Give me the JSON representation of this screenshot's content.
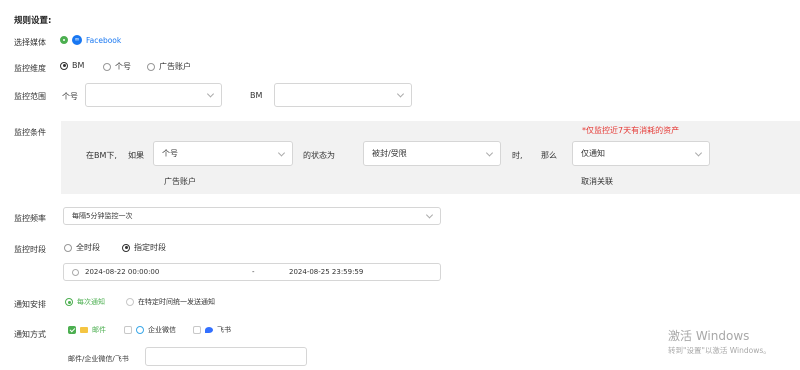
{
  "rule_title": "规则设置:",
  "media": {
    "label": "选择媒体",
    "option": "Facebook",
    "accent": "#1877f2"
  },
  "dimension": {
    "label": "监控维度",
    "options": [
      "BM",
      "个号",
      "广告账户"
    ],
    "selected": "BM"
  },
  "scope": {
    "label": "监控范围",
    "personal_label": "个号",
    "personal_value": "",
    "bm_label": "BM",
    "bm_value": ""
  },
  "condition": {
    "label": "监控条件",
    "prefix": "在BM下,",
    "if": "如果",
    "target": "个号",
    "target_sub": "广告账户",
    "status_of": "的状态为",
    "status": "被封/受限",
    "when": "时,",
    "then": "那么",
    "action": "仅通知",
    "action_sub": "取消关联",
    "note": "*仅监控近7天有消耗的资产",
    "note_color": "#e53935"
  },
  "frequency": {
    "label": "监控频率",
    "value": "每隔5分钟监控一次"
  },
  "period": {
    "label": "监控时段",
    "options": [
      "全时段",
      "指定时段"
    ],
    "selected": "指定时段",
    "start": "2024-08-22 00:00:00",
    "separator": "-",
    "end": "2024-08-25 23:59:59"
  },
  "schedule": {
    "label": "通知安排",
    "options": [
      "每次通知",
      "在特定时间统一发送通知"
    ],
    "selected": "每次通知",
    "accent": "#4caf50"
  },
  "method": {
    "label": "通知方式",
    "options": [
      "邮件",
      "企业微信",
      "飞书"
    ],
    "checked": "邮件",
    "field_label": "邮件/企业微信/飞书",
    "field_value": ""
  },
  "watermark": {
    "line1": "激活 Windows",
    "line2": "转到\"设置\"以激活 Windows。"
  }
}
